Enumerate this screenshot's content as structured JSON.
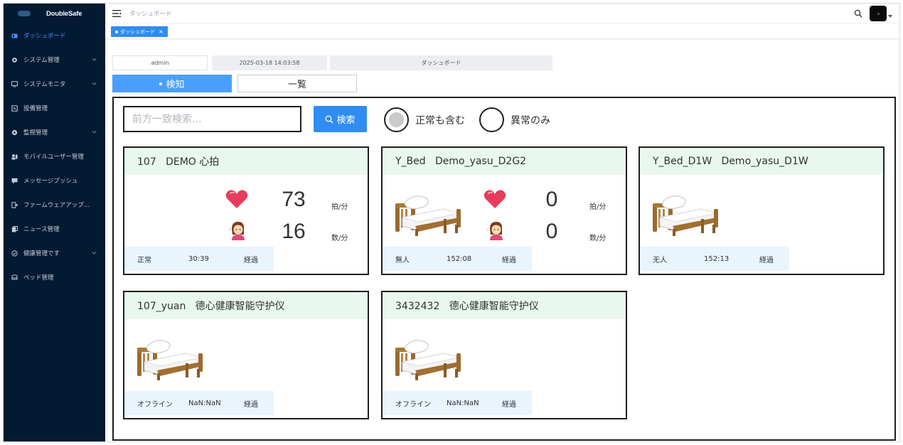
{
  "app": {
    "name": "DoubleSafe"
  },
  "sidebar": {
    "items": [
      {
        "label": "ダッシュボード",
        "icon": "dashboard-icon",
        "active": true,
        "has_caret": false
      },
      {
        "label": "システム管理",
        "icon": "gear-icon",
        "active": false,
        "has_caret": true
      },
      {
        "label": "システムモニタ",
        "icon": "monitor-icon",
        "active": false,
        "has_caret": true
      },
      {
        "label": "設備管理",
        "icon": "device-icon",
        "active": false,
        "has_caret": false
      },
      {
        "label": "監視管理",
        "icon": "watch-icon",
        "active": false,
        "has_caret": true
      },
      {
        "label": "モバイルユーザー管理",
        "icon": "mobile-user-icon",
        "active": false,
        "has_caret": false
      },
      {
        "label": "メッセージプッシュ",
        "icon": "message-icon",
        "active": false,
        "has_caret": false
      },
      {
        "label": "ファームウェアアップ…",
        "icon": "firmware-icon",
        "active": false,
        "has_caret": false
      },
      {
        "label": "ニュース管理",
        "icon": "news-icon",
        "active": false,
        "has_caret": false
      },
      {
        "label": "健康管理です",
        "icon": "health-icon",
        "active": false,
        "has_caret": true
      },
      {
        "label": "ベッド管理",
        "icon": "bed-manage-icon",
        "active": false,
        "has_caret": false
      }
    ]
  },
  "topbar": {
    "breadcrumb": "ダッシュボード"
  },
  "tags": [
    {
      "label": "ダッシュボード",
      "close": "×"
    }
  ],
  "info": {
    "user": "admin",
    "datetime": "2025-03-18 14:03:58",
    "page": "ダッシュボード"
  },
  "modes": {
    "detect": "検知",
    "list": "一覧"
  },
  "search": {
    "placeholder": "前方一致検索…",
    "button": "検索"
  },
  "filters": {
    "include_normal": "正常も含む",
    "abnormal_only": "異常のみ",
    "selected": "include_normal"
  },
  "colors": {
    "sidebar_bg": "#031a33",
    "accent": "#2f8cf0",
    "card_header": "#e9f8ee",
    "card_footer": "#eaf4fd"
  },
  "cards": [
    {
      "title": "107   DEMO 心拍",
      "has_bed": false,
      "has_vitals": true,
      "heart_rate": "73",
      "heart_unit": "拍/分",
      "breath_rate": "16",
      "breath_unit": "数/分",
      "status": "正常",
      "time": "30:39",
      "elapsed": "経過"
    },
    {
      "title": "Y_Bed   Demo_yasu_D2G2",
      "has_bed": true,
      "has_vitals": true,
      "heart_rate": "0",
      "heart_unit": "拍/分",
      "breath_rate": "0",
      "breath_unit": "数/分",
      "status": "無人",
      "time": "152:08",
      "elapsed": "経過"
    },
    {
      "title": "Y_Bed_D1W   Demo_yasu_D1W",
      "has_bed": true,
      "has_vitals": false,
      "status": "无人",
      "time": "152:13",
      "elapsed": "経過"
    },
    {
      "title": "107_yuan   德心健康智能守护仪",
      "has_bed": true,
      "has_vitals": false,
      "status": "オフライン",
      "time": "NaN:NaN",
      "elapsed": "経過"
    },
    {
      "title": "3432432   德心健康智能守护仪",
      "has_bed": true,
      "has_vitals": false,
      "status": "オフライン",
      "time": "NaN:NaN",
      "elapsed": "経過"
    }
  ]
}
